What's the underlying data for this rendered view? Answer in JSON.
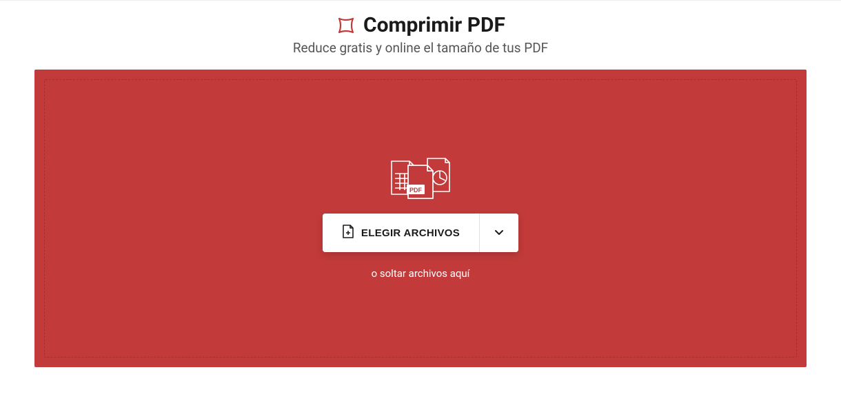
{
  "header": {
    "title": "Comprimir PDF",
    "subtitle": "Reduce gratis y online el tamaño de tus PDF"
  },
  "dropzone": {
    "choose_label": "ELEGIR ARCHIVOS",
    "drop_hint": "o soltar archivos aquí",
    "pdf_label": "PDF"
  },
  "colors": {
    "accent": "#c23a3a",
    "accent_dark": "#a82d2d"
  }
}
